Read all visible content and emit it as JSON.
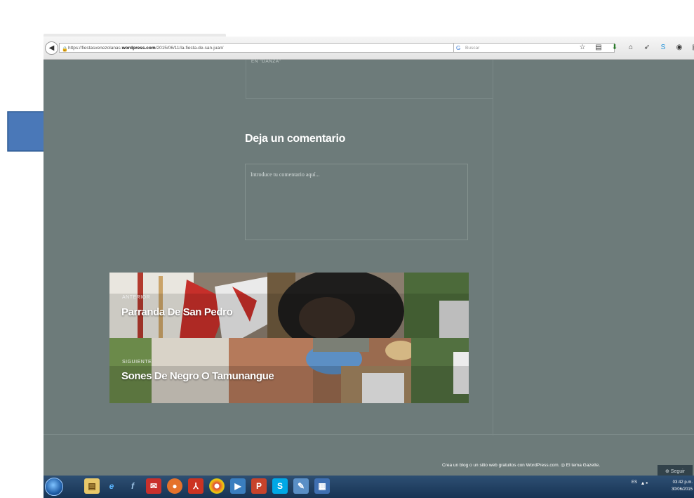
{
  "browser": {
    "url_prefix": "https://fiestasvenezolanas.",
    "url_domain": "wordpress.com",
    "url_path": "/2015/06/11/la-fiesta-de-san-juan/",
    "search_placeholder": "Buscar",
    "url_controls": "□ ▾ C"
  },
  "page": {
    "top_label": "EN \"DANZA\"",
    "comment_title": "Deja un comentario",
    "comment_placeholder": "Introduce tu comentario aquí...",
    "prev_small": "ANTERIOR",
    "prev_title": "Parranda De San Pedro",
    "next_small": "SIGUIENTE",
    "next_title": "Sones De Negro O Tamunangue",
    "footer_text": "Crea un blog o un sitio web gratuitos con WordPress.com. ◎ El tema Gazette.",
    "follow_label": "Seguir"
  },
  "taskbar": {
    "lang": "ES",
    "time": "03:42 p.m.",
    "date": "30/06/2015"
  },
  "colors": {
    "page_bg": "#6d7b7a",
    "arrow": "#4a78b8",
    "taskbar": "#1f3d60"
  },
  "icons": [
    "back-icon",
    "lock-icon",
    "search-icon",
    "star-icon",
    "clipboard-icon",
    "download-icon",
    "home-icon",
    "send-icon",
    "skype-icon",
    "pocket-icon",
    "menu-icon",
    "windows-start-icon",
    "ie-icon",
    "pdf-icon",
    "chrome-icon",
    "firefox-icon",
    "skype-taskbar-icon"
  ]
}
